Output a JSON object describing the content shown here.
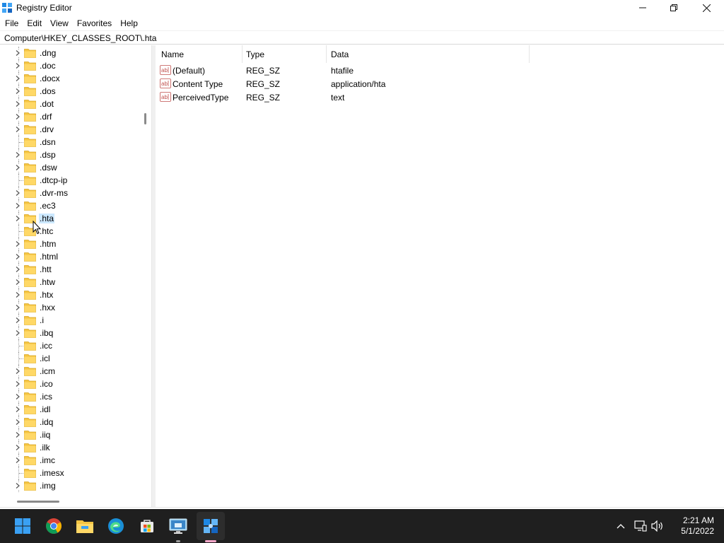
{
  "window": {
    "title": "Registry Editor",
    "minimize_glyph": "—",
    "maximize_glyph": "❐",
    "close_glyph": "✕"
  },
  "menu": [
    "File",
    "Edit",
    "View",
    "Favorites",
    "Help"
  ],
  "address": "Computer\\HKEY_CLASSES_ROOT\\.hta",
  "tree": {
    "items": [
      {
        "label": ".dng",
        "expandable": true
      },
      {
        "label": ".doc",
        "expandable": true
      },
      {
        "label": ".docx",
        "expandable": true
      },
      {
        "label": ".dos",
        "expandable": true
      },
      {
        "label": ".dot",
        "expandable": true
      },
      {
        "label": ".drf",
        "expandable": true
      },
      {
        "label": ".drv",
        "expandable": true
      },
      {
        "label": ".dsn",
        "expandable": false
      },
      {
        "label": ".dsp",
        "expandable": true
      },
      {
        "label": ".dsw",
        "expandable": true
      },
      {
        "label": ".dtcp-ip",
        "expandable": false
      },
      {
        "label": ".dvr-ms",
        "expandable": true
      },
      {
        "label": ".ec3",
        "expandable": true
      },
      {
        "label": ".hta",
        "expandable": true,
        "selected": true
      },
      {
        "label": ".htc",
        "expandable": false
      },
      {
        "label": ".htm",
        "expandable": true
      },
      {
        "label": ".html",
        "expandable": true
      },
      {
        "label": ".htt",
        "expandable": true
      },
      {
        "label": ".htw",
        "expandable": true
      },
      {
        "label": ".htx",
        "expandable": true
      },
      {
        "label": ".hxx",
        "expandable": true
      },
      {
        "label": ".i",
        "expandable": true
      },
      {
        "label": ".ibq",
        "expandable": true
      },
      {
        "label": ".icc",
        "expandable": false
      },
      {
        "label": ".icl",
        "expandable": false
      },
      {
        "label": ".icm",
        "expandable": true
      },
      {
        "label": ".ico",
        "expandable": true
      },
      {
        "label": ".ics",
        "expandable": true
      },
      {
        "label": ".idl",
        "expandable": true
      },
      {
        "label": ".idq",
        "expandable": true
      },
      {
        "label": ".iiq",
        "expandable": true
      },
      {
        "label": ".ilk",
        "expandable": true
      },
      {
        "label": ".imc",
        "expandable": true
      },
      {
        "label": ".imesx",
        "expandable": false
      },
      {
        "label": ".img",
        "expandable": true
      }
    ]
  },
  "values": {
    "headers": {
      "name": "Name",
      "type": "Type",
      "data": "Data"
    },
    "rows": [
      {
        "name": "(Default)",
        "type": "REG_SZ",
        "data": "htafile"
      },
      {
        "name": "Content Type",
        "type": "REG_SZ",
        "data": "application/hta"
      },
      {
        "name": "PerceivedType",
        "type": "REG_SZ",
        "data": "text"
      }
    ]
  },
  "taskbar": {
    "apps": [
      "start-icon",
      "chrome-icon",
      "file-explorer-icon",
      "edge-icon",
      "store-icon",
      "remote-desktop-icon",
      "registry-editor-icon"
    ],
    "colors": {
      "background": "#1f1f1f",
      "active_indicator": "#f4a6c8",
      "inactive_indicator": "#9a9a9a"
    }
  },
  "tray": {
    "time": "2:21 AM",
    "date": "5/1/2022"
  },
  "colors": {
    "selection": "#cce8ff",
    "folder": "#f5c542"
  }
}
